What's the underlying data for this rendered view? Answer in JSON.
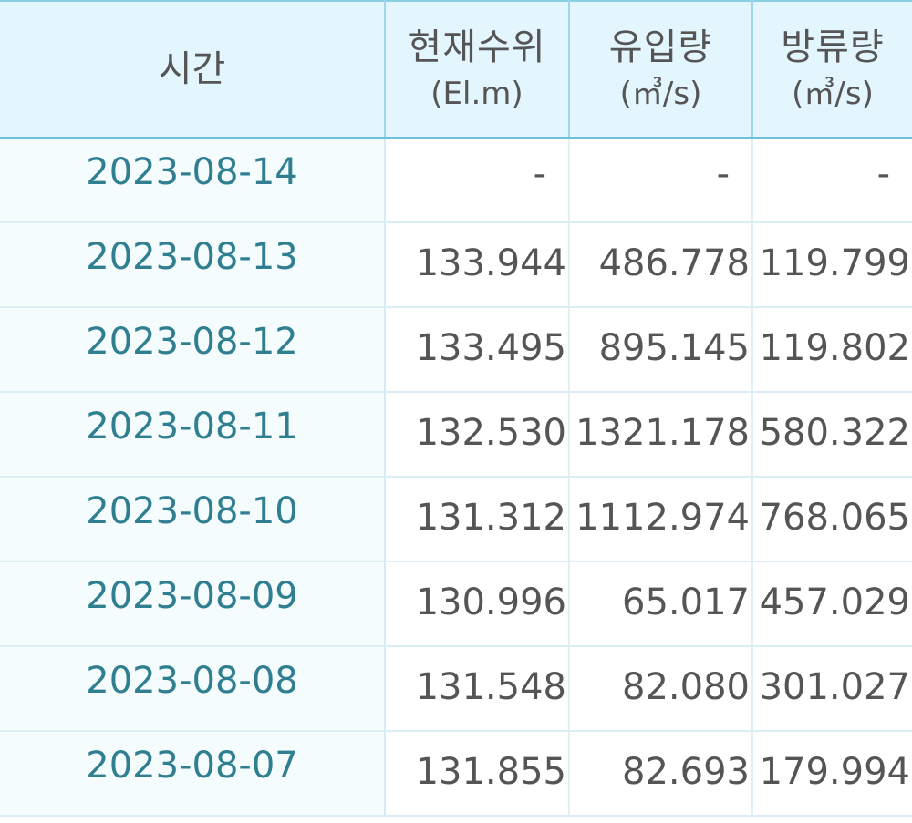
{
  "table": {
    "headers": {
      "time": "시간",
      "level": {
        "title": "현재수위",
        "unit": "(El.m)"
      },
      "inflow": {
        "title": "유입량",
        "unit": "(㎥/s)"
      },
      "outflow": {
        "title": "방류량",
        "unit": "(㎥/s)"
      }
    },
    "rows": [
      {
        "time": "2023-08-14",
        "level": "-",
        "inflow": "-",
        "outflow": "-"
      },
      {
        "time": "2023-08-13",
        "level": "133.944",
        "inflow": "486.778",
        "outflow": "119.799"
      },
      {
        "time": "2023-08-12",
        "level": "133.495",
        "inflow": "895.145",
        "outflow": "119.802"
      },
      {
        "time": "2023-08-11",
        "level": "132.530",
        "inflow": "1321.178",
        "outflow": "580.322"
      },
      {
        "time": "2023-08-10",
        "level": "131.312",
        "inflow": "1112.974",
        "outflow": "768.065"
      },
      {
        "time": "2023-08-09",
        "level": "130.996",
        "inflow": "65.017",
        "outflow": "457.029"
      },
      {
        "time": "2023-08-08",
        "level": "131.548",
        "inflow": "82.080",
        "outflow": "301.027"
      },
      {
        "time": "2023-08-07",
        "level": "131.855",
        "inflow": "82.693",
        "outflow": "179.994"
      }
    ]
  },
  "colors": {
    "header_bg": "#e3f6fd",
    "time_text": "#2f7f91",
    "value_text": "#555555",
    "border": "#8ccfe3"
  }
}
